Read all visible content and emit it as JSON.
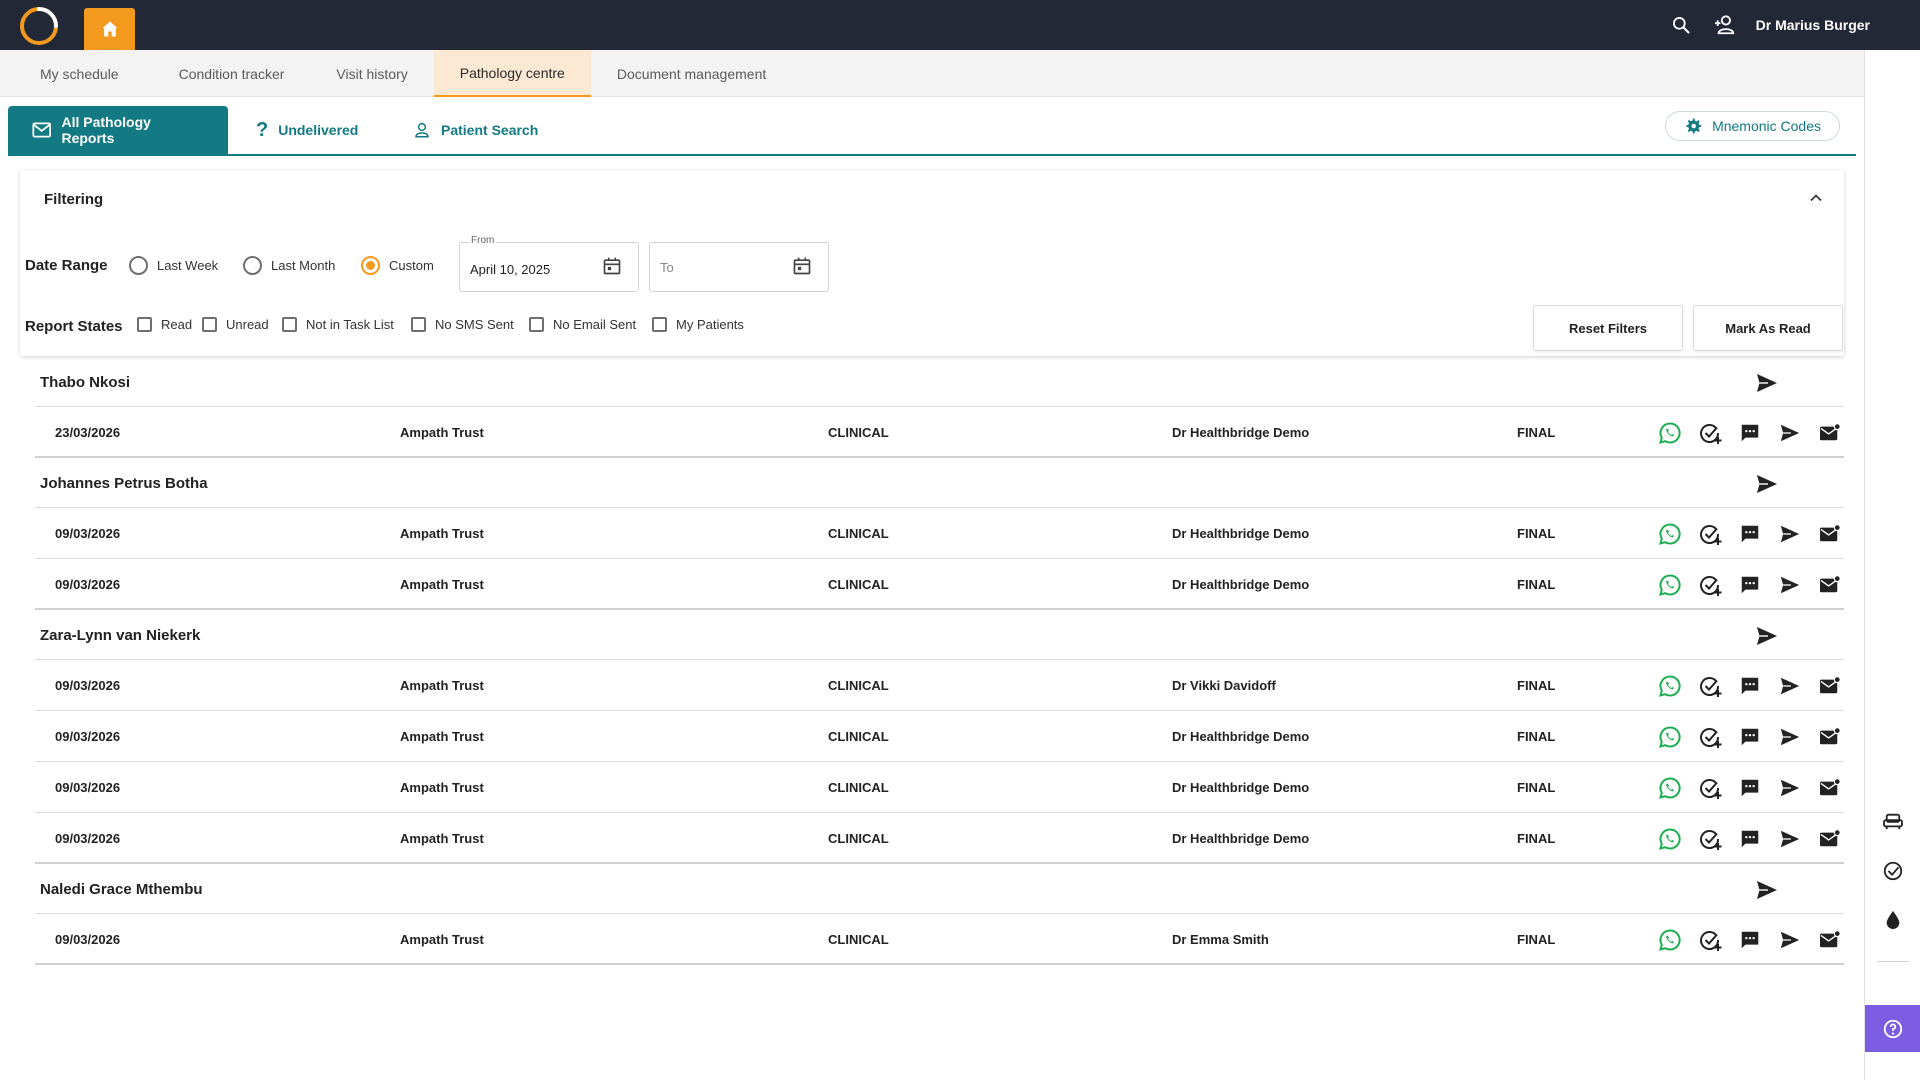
{
  "header": {
    "user_name": "Dr Marius Burger",
    "brand_color": "#f39a1e"
  },
  "main_nav": {
    "tabs": [
      {
        "label": "My schedule"
      },
      {
        "label": "Condition tracker"
      },
      {
        "label": "Visit history"
      },
      {
        "label": "Pathology centre",
        "active": true
      },
      {
        "label": "Document management"
      }
    ]
  },
  "sub_tabs": {
    "all_reports": "All Pathology Reports",
    "undelivered": "Undelivered",
    "patient_search": "Patient Search",
    "mnemonic_codes": "Mnemonic Codes",
    "accent_color": "#137a83"
  },
  "filtering": {
    "title": "Filtering",
    "date_range_label": "Date Range",
    "options": {
      "last_week": "Last Week",
      "last_month": "Last Month",
      "custom": "Custom"
    },
    "selected_option": "Custom",
    "from_label": "From",
    "from_value": "April 10, 2025",
    "to_placeholder": "To",
    "report_states_label": "Report States",
    "states": {
      "read": "Read",
      "unread": "Unread",
      "not_in_task_list": "Not in Task List",
      "no_sms_sent": "No SMS Sent",
      "no_email_sent": "No Email Sent",
      "my_patients": "My Patients"
    },
    "reset_filters": "Reset Filters",
    "mark_as_read": "Mark As Read"
  },
  "patients": [
    {
      "name": "Thabo Nkosi",
      "reports": [
        {
          "date": "23/03/2026",
          "lab": "Ampath Trust",
          "type": "CLINICAL",
          "doctor": "Dr Healthbridge Demo",
          "status": "FINAL"
        }
      ]
    },
    {
      "name": "Johannes Petrus Botha",
      "reports": [
        {
          "date": "09/03/2026",
          "lab": "Ampath Trust",
          "type": "CLINICAL",
          "doctor": "Dr Healthbridge Demo",
          "status": "FINAL"
        },
        {
          "date": "09/03/2026",
          "lab": "Ampath Trust",
          "type": "CLINICAL",
          "doctor": "Dr Healthbridge Demo",
          "status": "FINAL"
        }
      ]
    },
    {
      "name": "Zara-Lynn van Niekerk",
      "reports": [
        {
          "date": "09/03/2026",
          "lab": "Ampath Trust",
          "type": "CLINICAL",
          "doctor": "Dr Vikki Davidoff",
          "status": "FINAL"
        },
        {
          "date": "09/03/2026",
          "lab": "Ampath Trust",
          "type": "CLINICAL",
          "doctor": "Dr Healthbridge Demo",
          "status": "FINAL"
        },
        {
          "date": "09/03/2026",
          "lab": "Ampath Trust",
          "type": "CLINICAL",
          "doctor": "Dr Healthbridge Demo",
          "status": "FINAL"
        },
        {
          "date": "09/03/2026",
          "lab": "Ampath Trust",
          "type": "CLINICAL",
          "doctor": "Dr Healthbridge Demo",
          "status": "FINAL"
        }
      ]
    },
    {
      "name": "Naledi Grace Mthembu",
      "reports": [
        {
          "date": "09/03/2026",
          "lab": "Ampath Trust",
          "type": "CLINICAL",
          "doctor": "Dr Emma Smith",
          "status": "FINAL"
        }
      ]
    }
  ],
  "row_actions": [
    "whatsapp-icon",
    "task-add-icon",
    "sms-icon",
    "send-icon",
    "email-icon"
  ],
  "right_rail": [
    "couch-icon",
    "check-circle-icon",
    "drop-icon",
    "help-icon"
  ]
}
